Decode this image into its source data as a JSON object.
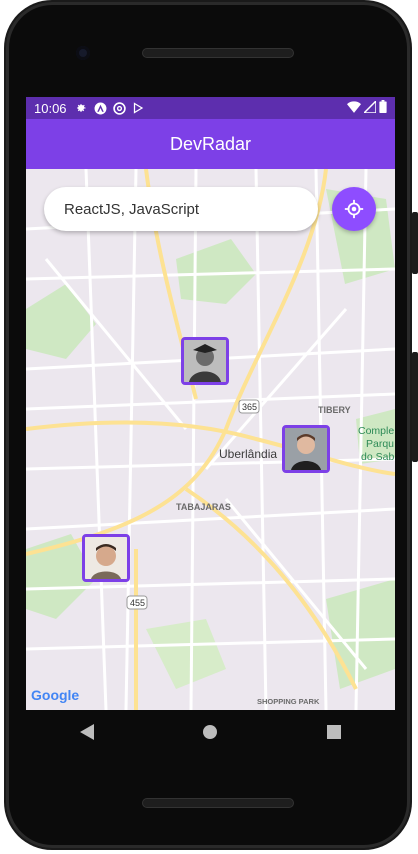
{
  "status_bar": {
    "time": "10:06",
    "icons": [
      "gear-icon",
      "android-auto-icon",
      "at-sign-icon",
      "play-protect-icon"
    ],
    "right_icons": [
      "wifi-icon",
      "signal-icon",
      "battery-icon"
    ]
  },
  "app_bar": {
    "title": "DevRadar"
  },
  "search": {
    "value": "ReactJS, JavaScript",
    "placeholder": ""
  },
  "location_button": {
    "icon": "my-location-icon"
  },
  "map": {
    "labels": {
      "city": "Uberlândia",
      "tibery": "TIBERY",
      "complexo": "Comple",
      "parque": "Parqu",
      "sabia": "do Sab",
      "tabajaras": "TABAJARAS",
      "shopping": "SHOPPING PARK",
      "route365": "365",
      "route455": "455",
      "google": "Google"
    },
    "markers": [
      {
        "name": "dev-marker-1"
      },
      {
        "name": "dev-marker-2"
      },
      {
        "name": "dev-marker-3"
      }
    ]
  },
  "colors": {
    "primary": "#7D40E7",
    "status": "#5D2EAE",
    "button": "#8E4DFF"
  },
  "nav": [
    "back-icon",
    "home-icon",
    "recents-icon"
  ]
}
